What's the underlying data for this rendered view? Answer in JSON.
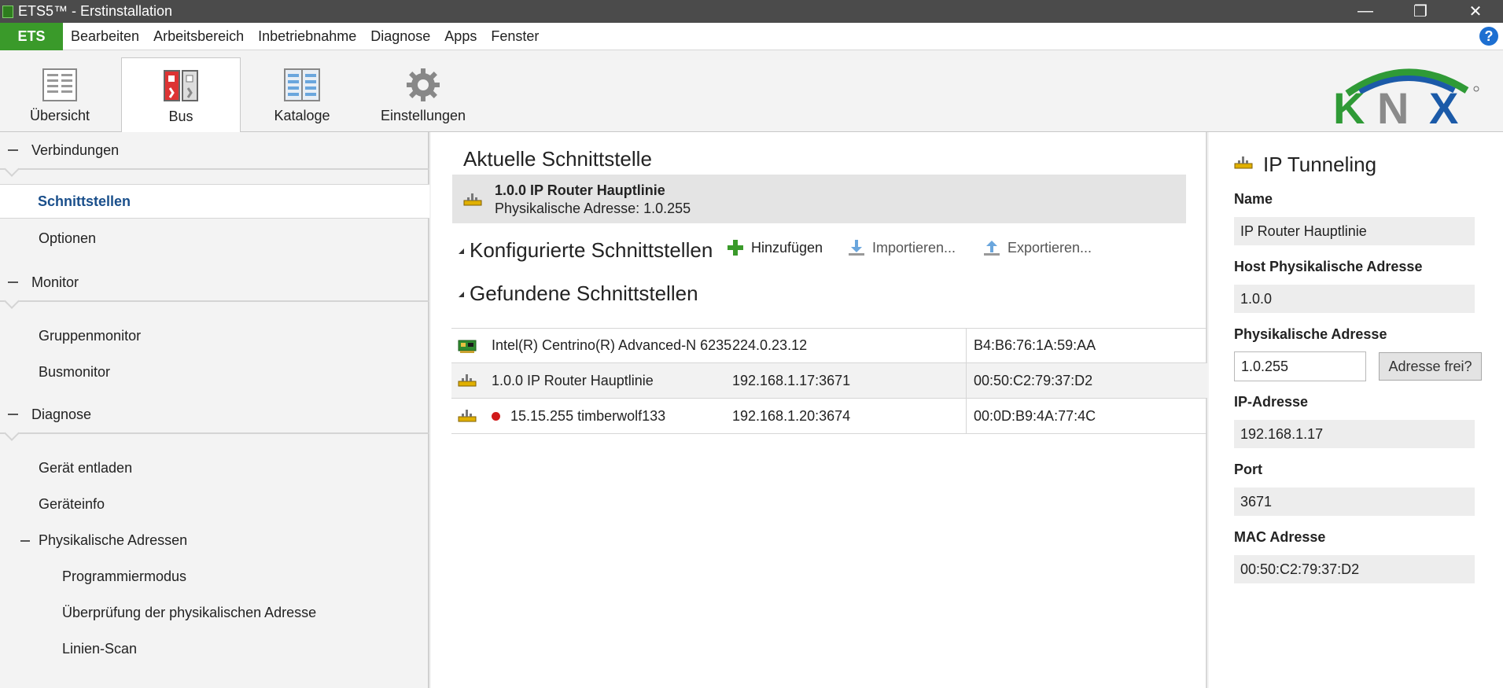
{
  "window": {
    "title": "ETS5™ - Erstinstallation",
    "controls": [
      "—",
      "❐",
      "✕"
    ]
  },
  "menubar": {
    "ets_label": "ETS",
    "items": [
      "Bearbeiten",
      "Arbeitsbereich",
      "Inbetriebnahme",
      "Diagnose",
      "Apps",
      "Fenster"
    ],
    "help_label": "?"
  },
  "ribbon": {
    "tabs": [
      {
        "label": "Übersicht",
        "icon": "overview-icon"
      },
      {
        "label": "Bus",
        "icon": "bus-icon",
        "active": true
      },
      {
        "label": "Kataloge",
        "icon": "catalog-icon"
      },
      {
        "label": "Einstellungen",
        "icon": "gear-icon"
      }
    ],
    "logo_text": "KNX"
  },
  "leftnav": {
    "groups": [
      {
        "label": "Verbindungen",
        "items": [
          "Schnittstellen",
          "Optionen"
        ],
        "selected": "Schnittstellen"
      },
      {
        "label": "Monitor",
        "items": [
          "Gruppenmonitor",
          "Busmonitor"
        ]
      },
      {
        "label": "Diagnose",
        "items": [
          "Gerät entladen",
          "Geräteinfo"
        ],
        "sub": {
          "label": "Physikalische Adressen",
          "items": [
            "Programmiermodus",
            "Überprüfung der physikalischen Adresse",
            "Linien-Scan"
          ]
        }
      }
    ]
  },
  "center": {
    "current_title": "Aktuelle Schnittstelle",
    "current": {
      "name": "1.0.0 IP Router Hauptlinie",
      "address": "Physikalische Adresse: 1.0.255"
    },
    "configured_title": "Konfigurierte Schnittstellen",
    "actions": {
      "add": "Hinzufügen",
      "import": "Importieren...",
      "export": "Exportieren..."
    },
    "found_title": "Gefundene Schnittstellen",
    "found": [
      {
        "name": "Intel(R) Centrino(R) Advanced-N 6235",
        "address": "224.0.23.12",
        "mac": "B4:B6:76:1A:59:AA",
        "icon": "network-card-icon"
      },
      {
        "name": "1.0.0 IP Router Hauptlinie",
        "address": "192.168.1.17:3671",
        "mac": "00:50:C2:79:37:D2",
        "icon": "router-icon"
      },
      {
        "name": "15.15.255 timberwolf133",
        "address": "192.168.1.20:3674",
        "mac": "00:0D:B9:4A:77:4C",
        "icon": "router-icon",
        "status": "red"
      }
    ]
  },
  "details": {
    "title": "IP Tunneling",
    "name_label": "Name",
    "name_value": "IP Router Hauptlinie",
    "host_label": "Host Physikalische Adresse",
    "host_value": "1.0.0",
    "phys_label": "Physikalische Adresse",
    "phys_value": "1.0.255",
    "phys_button": "Adresse frei?",
    "ip_label": "IP-Adresse",
    "ip_value": "192.168.1.17",
    "port_label": "Port",
    "port_value": "3671",
    "mac_label": "MAC Adresse",
    "mac_value": "00:50:C2:79:37:D2"
  },
  "colors": {
    "ets_green": "#3a9a2a",
    "selected_text": "#1a4f8b",
    "help_blue": "#1d6fd1",
    "status_red": "#d01a1a"
  }
}
